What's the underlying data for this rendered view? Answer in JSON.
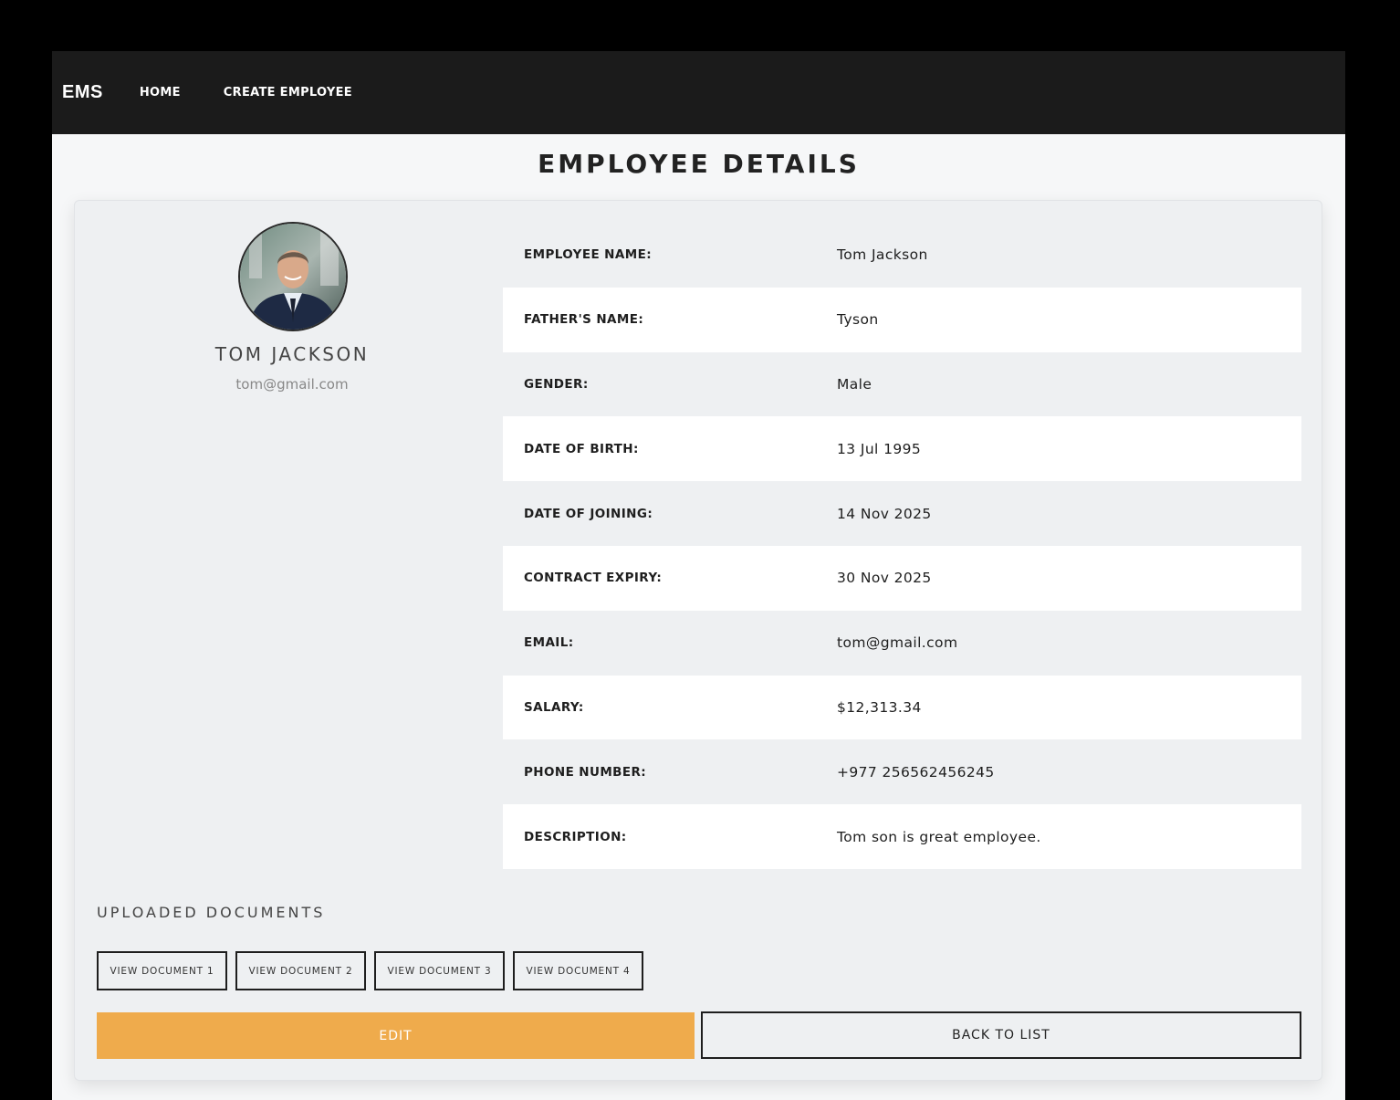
{
  "navbar": {
    "brand": "EMS",
    "links": [
      "HOME",
      "CREATE EMPLOYEE"
    ]
  },
  "page_title": "EMPLOYEE DETAILS",
  "profile": {
    "name": "TOM JACKSON",
    "email": "tom@gmail.com",
    "avatar": "profile-photo"
  },
  "details": [
    {
      "label": "EMPLOYEE NAME:",
      "value": "Tom Jackson"
    },
    {
      "label": "FATHER'S NAME:",
      "value": "Tyson"
    },
    {
      "label": "GENDER:",
      "value": "Male"
    },
    {
      "label": "DATE OF BIRTH:",
      "value": "13 Jul 1995"
    },
    {
      "label": "DATE OF JOINING:",
      "value": "14 Nov 2025"
    },
    {
      "label": "CONTRACT EXPIRY:",
      "value": "30 Nov 2025"
    },
    {
      "label": "EMAIL:",
      "value": "tom@gmail.com"
    },
    {
      "label": "SALARY:",
      "value": "$12,313.34"
    },
    {
      "label": "PHONE NUMBER:",
      "value": "+977 256562456245"
    },
    {
      "label": "DESCRIPTION:",
      "value": "Tom son is great employee."
    }
  ],
  "documents": {
    "title": "UPLOADED DOCUMENTS",
    "buttons": [
      "VIEW DOCUMENT 1",
      "VIEW DOCUMENT 2",
      "VIEW DOCUMENT 3",
      "VIEW DOCUMENT 4"
    ]
  },
  "actions": {
    "edit": "EDIT",
    "back": "BACK TO LIST"
  },
  "colors": {
    "navbar": "#1b1b1b",
    "edit_button": "#efab4c",
    "card": "#eef0f2"
  }
}
